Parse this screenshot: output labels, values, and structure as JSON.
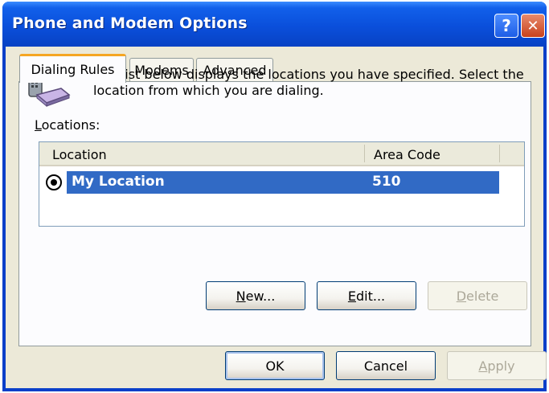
{
  "window": {
    "title": "Phone and Modem Options",
    "help_glyph": "?",
    "close_glyph": "✕"
  },
  "tabs": [
    {
      "label": "Dialing Rules",
      "active": true
    },
    {
      "label": "Modems",
      "active": false
    },
    {
      "label": "Advanced",
      "active": false
    }
  ],
  "dialing_rules": {
    "description": "The list below displays the locations you have specified. Select the location from which you are dialing.",
    "locations_label": {
      "accel": "L",
      "rest": "ocations:"
    },
    "columns": [
      "Location",
      "Area Code"
    ],
    "rows": [
      {
        "location": "My Location",
        "area_code": "510",
        "selected": true
      }
    ],
    "buttons": {
      "new": {
        "accel": "N",
        "rest": "ew..."
      },
      "edit": {
        "accel": "E",
        "rest": "dit..."
      },
      "delete": {
        "accel": "D",
        "rest": "elete"
      }
    }
  },
  "footer": {
    "ok": "OK",
    "cancel": "Cancel",
    "apply": {
      "accel": "A",
      "rest": "pply"
    }
  },
  "icons": {
    "title_help": "help-icon",
    "title_close": "close-icon",
    "header_graphic": "phone-modem-icon",
    "row_indicator": "current-location-icon"
  },
  "colors": {
    "title_bar": "#0a4fdb",
    "selection": "#316ac5",
    "dialog_bg": "#ece9d8",
    "active_tab_accent": "#f5a623"
  }
}
